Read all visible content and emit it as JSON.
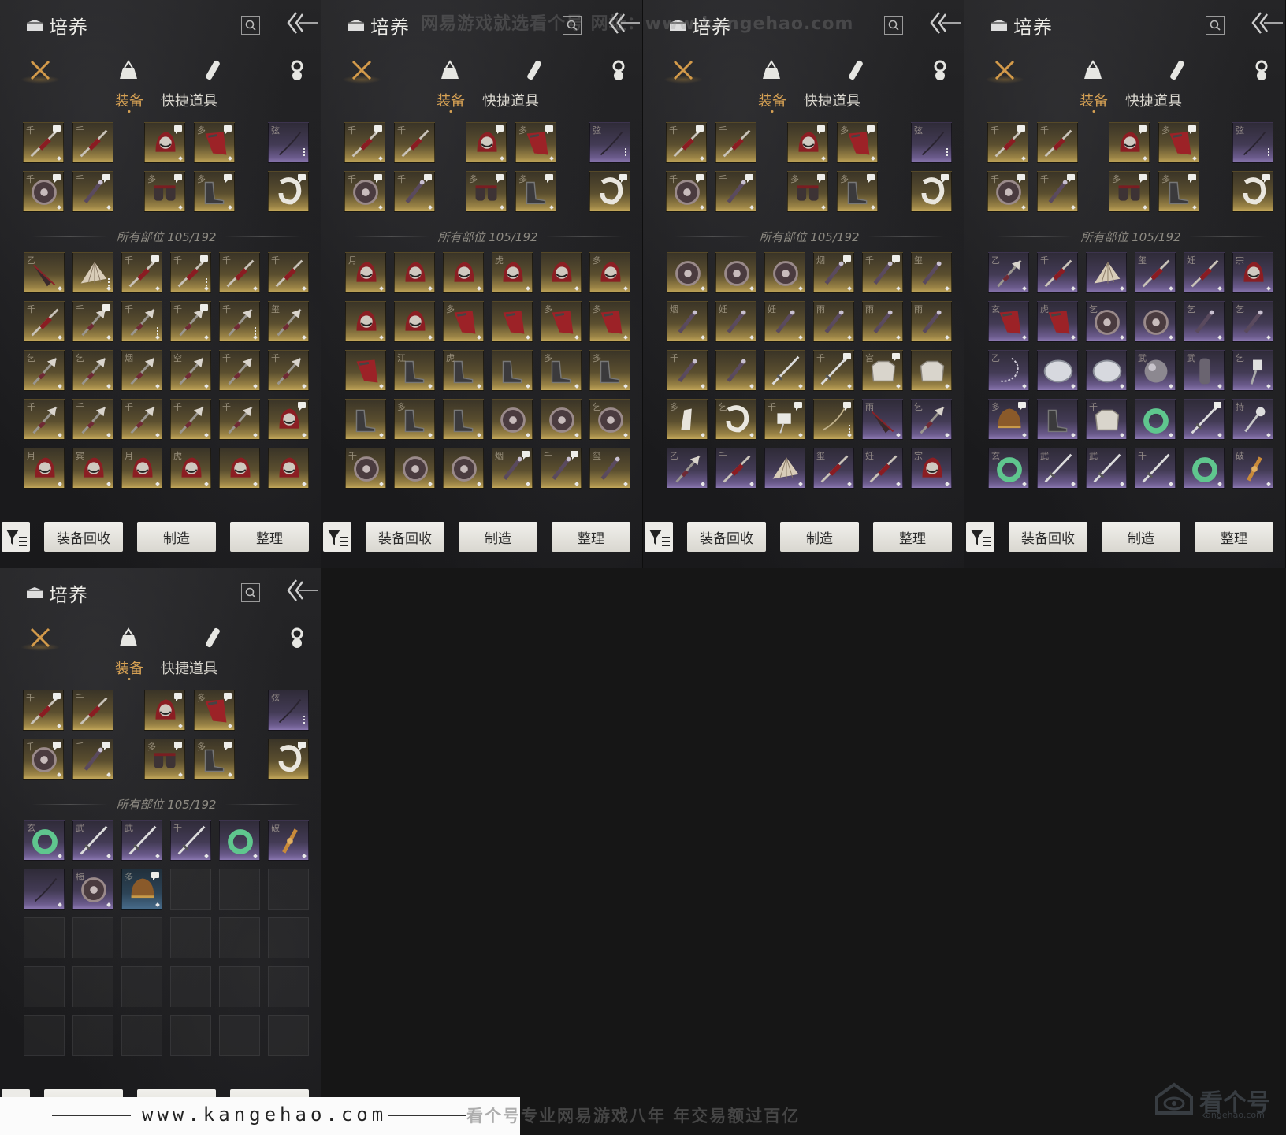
{
  "panel": {
    "title": "培养",
    "subtabs": [
      "装备",
      "快捷道具"
    ],
    "categories": [
      "weapons-icon",
      "pouch-icon",
      "scroll-icon",
      "accessory-icon"
    ],
    "section_label": "所有部位 105/192",
    "buttons": [
      "装备回收",
      "制造",
      "整理"
    ]
  },
  "watermark_top": "网易游戏就选看个号 网址：www.kangehao.com",
  "footer": {
    "url": "www.kangehao.com",
    "slogan": "看个号专业网易游戏八年 年交易额过百亿",
    "logo_text": "看个号",
    "logo_sub": "kangehao.com"
  },
  "equipped": [
    {
      "g": "千",
      "q": "gold",
      "icon": "spear",
      "badge": true,
      "corner": true
    },
    {
      "g": "千",
      "q": "gold",
      "icon": "spear",
      "badge": false,
      "corner": false
    },
    {
      "g": "",
      "q": "gold",
      "icon": "helmet",
      "badge": true,
      "corner": true
    },
    {
      "g": "多",
      "q": "gold",
      "icon": "cape",
      "badge": true,
      "corner": true
    },
    {
      "g": "弦",
      "q": "purple",
      "icon": "bow",
      "badge": false,
      "corner": false,
      "dots": true
    },
    {
      "g": "千",
      "q": "gold",
      "icon": "shield",
      "badge": true,
      "corner": true
    },
    {
      "g": "千",
      "q": "gold",
      "icon": "knife",
      "badge": true,
      "corner": true
    },
    {
      "g": "多",
      "q": "gold",
      "icon": "bracers",
      "badge": true,
      "corner": true
    },
    {
      "g": "多",
      "q": "gold",
      "icon": "boots",
      "badge": true,
      "corner": true
    },
    {
      "g": "",
      "q": "gold",
      "icon": "ring",
      "badge": true,
      "corner": false
    }
  ],
  "panels": [
    {
      "inventory": [
        {
          "g": "乙",
          "q": "gold",
          "icon": "umbrella"
        },
        {
          "g": "",
          "q": "gold",
          "icon": "fan",
          "dots": true
        },
        {
          "g": "千",
          "q": "gold",
          "icon": "spear",
          "badge": true
        },
        {
          "g": "千",
          "q": "gold",
          "icon": "spear",
          "badge": true,
          "dots": true
        },
        {
          "g": "千",
          "q": "gold",
          "icon": "spear"
        },
        {
          "g": "千",
          "q": "gold",
          "icon": "spear"
        },
        {
          "g": "千",
          "q": "gold",
          "icon": "spear"
        },
        {
          "g": "千",
          "q": "gold",
          "icon": "axe",
          "badge": true
        },
        {
          "g": "千",
          "q": "gold",
          "icon": "axe",
          "dots": true
        },
        {
          "g": "千",
          "q": "gold",
          "icon": "axe",
          "badge": true
        },
        {
          "g": "千",
          "q": "gold",
          "icon": "axe",
          "dots": true
        },
        {
          "g": "玺",
          "q": "gold",
          "icon": "axe"
        },
        {
          "g": "乞",
          "q": "gold",
          "icon": "axe"
        },
        {
          "g": "乞",
          "q": "gold",
          "icon": "axe"
        },
        {
          "g": "烟",
          "q": "gold",
          "icon": "axe"
        },
        {
          "g": "空",
          "q": "gold",
          "icon": "axe"
        },
        {
          "g": "千",
          "q": "gold",
          "icon": "axe"
        },
        {
          "g": "千",
          "q": "gold",
          "icon": "axe"
        },
        {
          "g": "千",
          "q": "gold",
          "icon": "axe"
        },
        {
          "g": "千",
          "q": "gold",
          "icon": "axe"
        },
        {
          "g": "千",
          "q": "gold",
          "icon": "axe"
        },
        {
          "g": "千",
          "q": "gold",
          "icon": "axe"
        },
        {
          "g": "千",
          "q": "gold",
          "icon": "axe"
        },
        {
          "g": "",
          "q": "gold",
          "icon": "helmet",
          "badge": true
        },
        {
          "g": "月",
          "q": "gold",
          "icon": "helmet"
        },
        {
          "g": "宾",
          "q": "gold",
          "icon": "helmet"
        },
        {
          "g": "月",
          "q": "gold",
          "icon": "helmet"
        },
        {
          "g": "虎",
          "q": "gold",
          "icon": "helmet"
        },
        {
          "g": "",
          "q": "gold",
          "icon": "helmet"
        },
        {
          "g": "",
          "q": "gold",
          "icon": "helmet"
        }
      ]
    },
    {
      "inventory": [
        {
          "g": "月",
          "q": "gold",
          "icon": "helmet"
        },
        {
          "g": "",
          "q": "gold",
          "icon": "helmet"
        },
        {
          "g": "",
          "q": "gold",
          "icon": "helmet"
        },
        {
          "g": "虎",
          "q": "gold",
          "icon": "helmet"
        },
        {
          "g": "",
          "q": "gold",
          "icon": "helmet"
        },
        {
          "g": "多",
          "q": "gold",
          "icon": "helmet"
        },
        {
          "g": "",
          "q": "gold",
          "icon": "helmet"
        },
        {
          "g": "",
          "q": "gold",
          "icon": "helmet"
        },
        {
          "g": "多",
          "q": "gold",
          "icon": "cape"
        },
        {
          "g": "",
          "q": "gold",
          "icon": "cape"
        },
        {
          "g": "多",
          "q": "gold",
          "icon": "cape"
        },
        {
          "g": "多",
          "q": "gold",
          "icon": "cape"
        },
        {
          "g": "",
          "q": "gold",
          "icon": "cape"
        },
        {
          "g": "江",
          "q": "gold",
          "icon": "boots"
        },
        {
          "g": "虎",
          "q": "gold",
          "icon": "boots"
        },
        {
          "g": "",
          "q": "gold",
          "icon": "boots"
        },
        {
          "g": "多",
          "q": "gold",
          "icon": "boots"
        },
        {
          "g": "多",
          "q": "gold",
          "icon": "boots"
        },
        {
          "g": "",
          "q": "gold",
          "icon": "boots"
        },
        {
          "g": "多",
          "q": "gold",
          "icon": "boots"
        },
        {
          "g": "",
          "q": "gold",
          "icon": "boots"
        },
        {
          "g": "",
          "q": "gold",
          "icon": "shield"
        },
        {
          "g": "",
          "q": "gold",
          "icon": "shield"
        },
        {
          "g": "乞",
          "q": "gold",
          "icon": "shield"
        },
        {
          "g": "千",
          "q": "gold",
          "icon": "shield"
        },
        {
          "g": "",
          "q": "gold",
          "icon": "shield"
        },
        {
          "g": "",
          "q": "gold",
          "icon": "shield"
        },
        {
          "g": "烟",
          "q": "gold",
          "icon": "knife",
          "badge": true
        },
        {
          "g": "千",
          "q": "gold",
          "icon": "knife",
          "badge": true
        },
        {
          "g": "玺",
          "q": "gold",
          "icon": "knife"
        }
      ]
    },
    {
      "inventory": [
        {
          "g": "",
          "q": "gold",
          "icon": "shield"
        },
        {
          "g": "",
          "q": "gold",
          "icon": "shield"
        },
        {
          "g": "",
          "q": "gold",
          "icon": "shield"
        },
        {
          "g": "烟",
          "q": "gold",
          "icon": "knife",
          "badge": true
        },
        {
          "g": "千",
          "q": "gold",
          "icon": "knife",
          "badge": true
        },
        {
          "g": "玺",
          "q": "gold",
          "icon": "knife"
        },
        {
          "g": "烟",
          "q": "gold",
          "icon": "knife"
        },
        {
          "g": "妊",
          "q": "gold",
          "icon": "knife"
        },
        {
          "g": "妊",
          "q": "gold",
          "icon": "knife"
        },
        {
          "g": "雨",
          "q": "gold",
          "icon": "knife"
        },
        {
          "g": "雨",
          "q": "gold",
          "icon": "knife"
        },
        {
          "g": "雨",
          "q": "gold",
          "icon": "knife"
        },
        {
          "g": "千",
          "q": "gold",
          "icon": "knife"
        },
        {
          "g": "",
          "q": "gold",
          "icon": "knife"
        },
        {
          "g": "",
          "q": "gold",
          "icon": "sword"
        },
        {
          "g": "千",
          "q": "gold",
          "icon": "sword",
          "badge": true
        },
        {
          "g": "宫",
          "q": "gold",
          "icon": "armor",
          "badge": true
        },
        {
          "g": "",
          "q": "gold",
          "icon": "armor"
        },
        {
          "g": "多",
          "q": "gold",
          "icon": "amulet"
        },
        {
          "g": "乞",
          "q": "gold",
          "icon": "ring"
        },
        {
          "g": "千",
          "q": "gold",
          "icon": "bell",
          "badge": true
        },
        {
          "g": "",
          "q": "gold",
          "icon": "whip",
          "badge": true,
          "dots": true
        },
        {
          "g": "雨",
          "q": "purple",
          "icon": "umbrella"
        },
        {
          "g": "乞",
          "q": "purple",
          "icon": "axe"
        },
        {
          "g": "乙",
          "q": "purple",
          "icon": "axe"
        },
        {
          "g": "千",
          "q": "purple",
          "icon": "spear"
        },
        {
          "g": "",
          "q": "purple",
          "icon": "fan"
        },
        {
          "g": "玺",
          "q": "purple",
          "icon": "spear"
        },
        {
          "g": "妊",
          "q": "purple",
          "icon": "spear"
        },
        {
          "g": "宗",
          "q": "purple",
          "icon": "helmet"
        }
      ]
    },
    {
      "inventory": [
        {
          "g": "乙",
          "q": "purple",
          "icon": "axe"
        },
        {
          "g": "千",
          "q": "purple",
          "icon": "spear"
        },
        {
          "g": "",
          "q": "purple",
          "icon": "fan"
        },
        {
          "g": "玺",
          "q": "purple",
          "icon": "spear"
        },
        {
          "g": "妊",
          "q": "purple",
          "icon": "spear"
        },
        {
          "g": "宗",
          "q": "purple",
          "icon": "helmet"
        },
        {
          "g": "玄",
          "q": "purple",
          "icon": "cape"
        },
        {
          "g": "虎",
          "q": "purple",
          "icon": "cape"
        },
        {
          "g": "乞",
          "q": "purple",
          "icon": "shield"
        },
        {
          "g": "",
          "q": "purple",
          "icon": "shield"
        },
        {
          "g": "乞",
          "q": "purple",
          "icon": "knife"
        },
        {
          "g": "乞",
          "q": "purple",
          "icon": "knife"
        },
        {
          "g": "乙",
          "q": "purple",
          "icon": "chain"
        },
        {
          "g": "",
          "q": "purple",
          "icon": "disc"
        },
        {
          "g": "",
          "q": "purple",
          "icon": "disc"
        },
        {
          "g": "武",
          "q": "purple",
          "icon": "orb"
        },
        {
          "g": "武",
          "q": "purple",
          "icon": "cuff"
        },
        {
          "g": "乞",
          "q": "purple",
          "icon": "hammer"
        },
        {
          "g": "多",
          "q": "purple",
          "icon": "hat",
          "badge": true
        },
        {
          "g": "",
          "q": "purple",
          "icon": "boots"
        },
        {
          "g": "千",
          "q": "purple",
          "icon": "armor"
        },
        {
          "g": "",
          "q": "purple",
          "icon": "jade"
        },
        {
          "g": "",
          "q": "purple",
          "icon": "sword",
          "badge": true
        },
        {
          "g": "持",
          "q": "purple",
          "icon": "mace"
        },
        {
          "g": "玄",
          "q": "purple",
          "icon": "jade"
        },
        {
          "g": "武",
          "q": "purple",
          "icon": "sword"
        },
        {
          "g": "武",
          "q": "purple",
          "icon": "sword"
        },
        {
          "g": "千",
          "q": "purple",
          "icon": "sword"
        },
        {
          "g": "",
          "q": "purple",
          "icon": "jade"
        },
        {
          "g": "破",
          "q": "purple",
          "icon": "vajra"
        }
      ]
    },
    {
      "inventory": [
        {
          "g": "玄",
          "q": "purple",
          "icon": "jade"
        },
        {
          "g": "武",
          "q": "purple",
          "icon": "sword"
        },
        {
          "g": "武",
          "q": "purple",
          "icon": "sword"
        },
        {
          "g": "千",
          "q": "purple",
          "icon": "sword"
        },
        {
          "g": "",
          "q": "purple",
          "icon": "jade"
        },
        {
          "g": "破",
          "q": "purple",
          "icon": "vajra"
        },
        {
          "g": "",
          "q": "purple",
          "icon": "bow"
        },
        {
          "g": "梅",
          "q": "purple",
          "icon": "shield"
        },
        {
          "g": "多",
          "q": "blue",
          "icon": "hat",
          "badge": true
        },
        {
          "g": "",
          "q": "empty",
          "icon": ""
        },
        {
          "g": "",
          "q": "empty",
          "icon": ""
        },
        {
          "g": "",
          "q": "empty",
          "icon": ""
        },
        {
          "g": "",
          "q": "empty",
          "icon": ""
        },
        {
          "g": "",
          "q": "empty",
          "icon": ""
        },
        {
          "g": "",
          "q": "empty",
          "icon": ""
        },
        {
          "g": "",
          "q": "empty",
          "icon": ""
        },
        {
          "g": "",
          "q": "empty",
          "icon": ""
        },
        {
          "g": "",
          "q": "empty",
          "icon": ""
        },
        {
          "g": "",
          "q": "empty",
          "icon": ""
        },
        {
          "g": "",
          "q": "empty",
          "icon": ""
        },
        {
          "g": "",
          "q": "empty",
          "icon": ""
        },
        {
          "g": "",
          "q": "empty",
          "icon": ""
        },
        {
          "g": "",
          "q": "empty",
          "icon": ""
        },
        {
          "g": "",
          "q": "empty",
          "icon": ""
        },
        {
          "g": "",
          "q": "empty",
          "icon": ""
        },
        {
          "g": "",
          "q": "empty",
          "icon": ""
        },
        {
          "g": "",
          "q": "empty",
          "icon": ""
        },
        {
          "g": "",
          "q": "empty",
          "icon": ""
        },
        {
          "g": "",
          "q": "empty",
          "icon": ""
        },
        {
          "g": "",
          "q": "empty",
          "icon": ""
        }
      ]
    }
  ]
}
